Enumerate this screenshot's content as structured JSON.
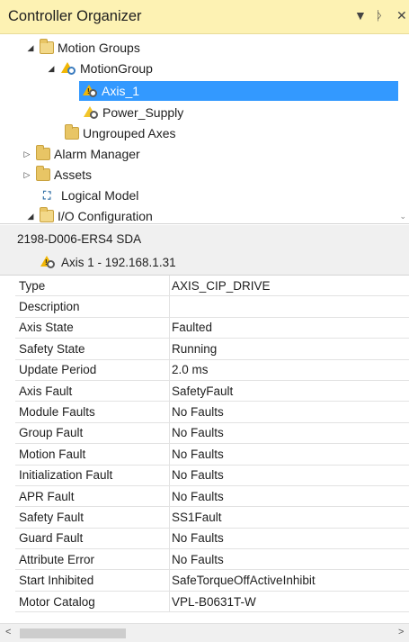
{
  "panel": {
    "title": "Controller Organizer",
    "dropdown_icon": "▼",
    "pin_icon": "ᚦ",
    "close_icon": "✕"
  },
  "tree": {
    "items": [
      {
        "label": "Motion Groups",
        "expander": "◢",
        "icon": "folder-open-icon"
      },
      {
        "label": "MotionGroup",
        "expander": "◢",
        "icon": "motion-group-icon"
      },
      {
        "label": "Axis_1",
        "expander": "",
        "icon": "axis-warning-icon",
        "selected": true
      },
      {
        "label": "Power_Supply",
        "expander": "",
        "icon": "power-supply-icon"
      },
      {
        "label": "Ungrouped Axes",
        "expander": "",
        "icon": "folder-icon"
      },
      {
        "label": "Alarm Manager",
        "expander": "▷",
        "icon": "folder-icon"
      },
      {
        "label": "Assets",
        "expander": "▷",
        "icon": "folder-icon"
      },
      {
        "label": "Logical Model",
        "expander": "",
        "icon": "logical-model-icon"
      },
      {
        "label": "I/O Configuration",
        "expander": "◢",
        "icon": "folder-open-icon"
      }
    ]
  },
  "properties": {
    "device": "2198-D006-ERS4 SDA",
    "subtitle": "Axis 1 - 192.168.1.31",
    "rows": [
      {
        "name": "Type",
        "value": "AXIS_CIP_DRIVE"
      },
      {
        "name": "Description",
        "value": ""
      },
      {
        "name": "Axis State",
        "value": "Faulted"
      },
      {
        "name": "Safety State",
        "value": "Running"
      },
      {
        "name": "Update Period",
        "value": "2.0 ms"
      },
      {
        "name": "Axis Fault",
        "value": "SafetyFault"
      },
      {
        "name": "Module Faults",
        "value": "No Faults"
      },
      {
        "name": "Group Fault",
        "value": "No Faults"
      },
      {
        "name": "Motion Fault",
        "value": "No Faults"
      },
      {
        "name": "Initialization Fault",
        "value": "No Faults"
      },
      {
        "name": "APR Fault",
        "value": "No Faults"
      },
      {
        "name": "Safety Fault",
        "value": "SS1Fault"
      },
      {
        "name": "Guard Fault",
        "value": "No Faults"
      },
      {
        "name": "Attribute Error",
        "value": "No Faults"
      },
      {
        "name": "Start Inhibited",
        "value": "SafeTorqueOffActiveInhibit"
      },
      {
        "name": "Motor Catalog",
        "value": "VPL-B0631T-W"
      }
    ]
  },
  "scrollbar": {
    "left_icon": "<",
    "right_icon": ">"
  },
  "colors": {
    "titlebar_bg": "#fdf2b3",
    "selection": "#3399ff",
    "folder": "#e8c565",
    "warning": "#f2b705"
  }
}
